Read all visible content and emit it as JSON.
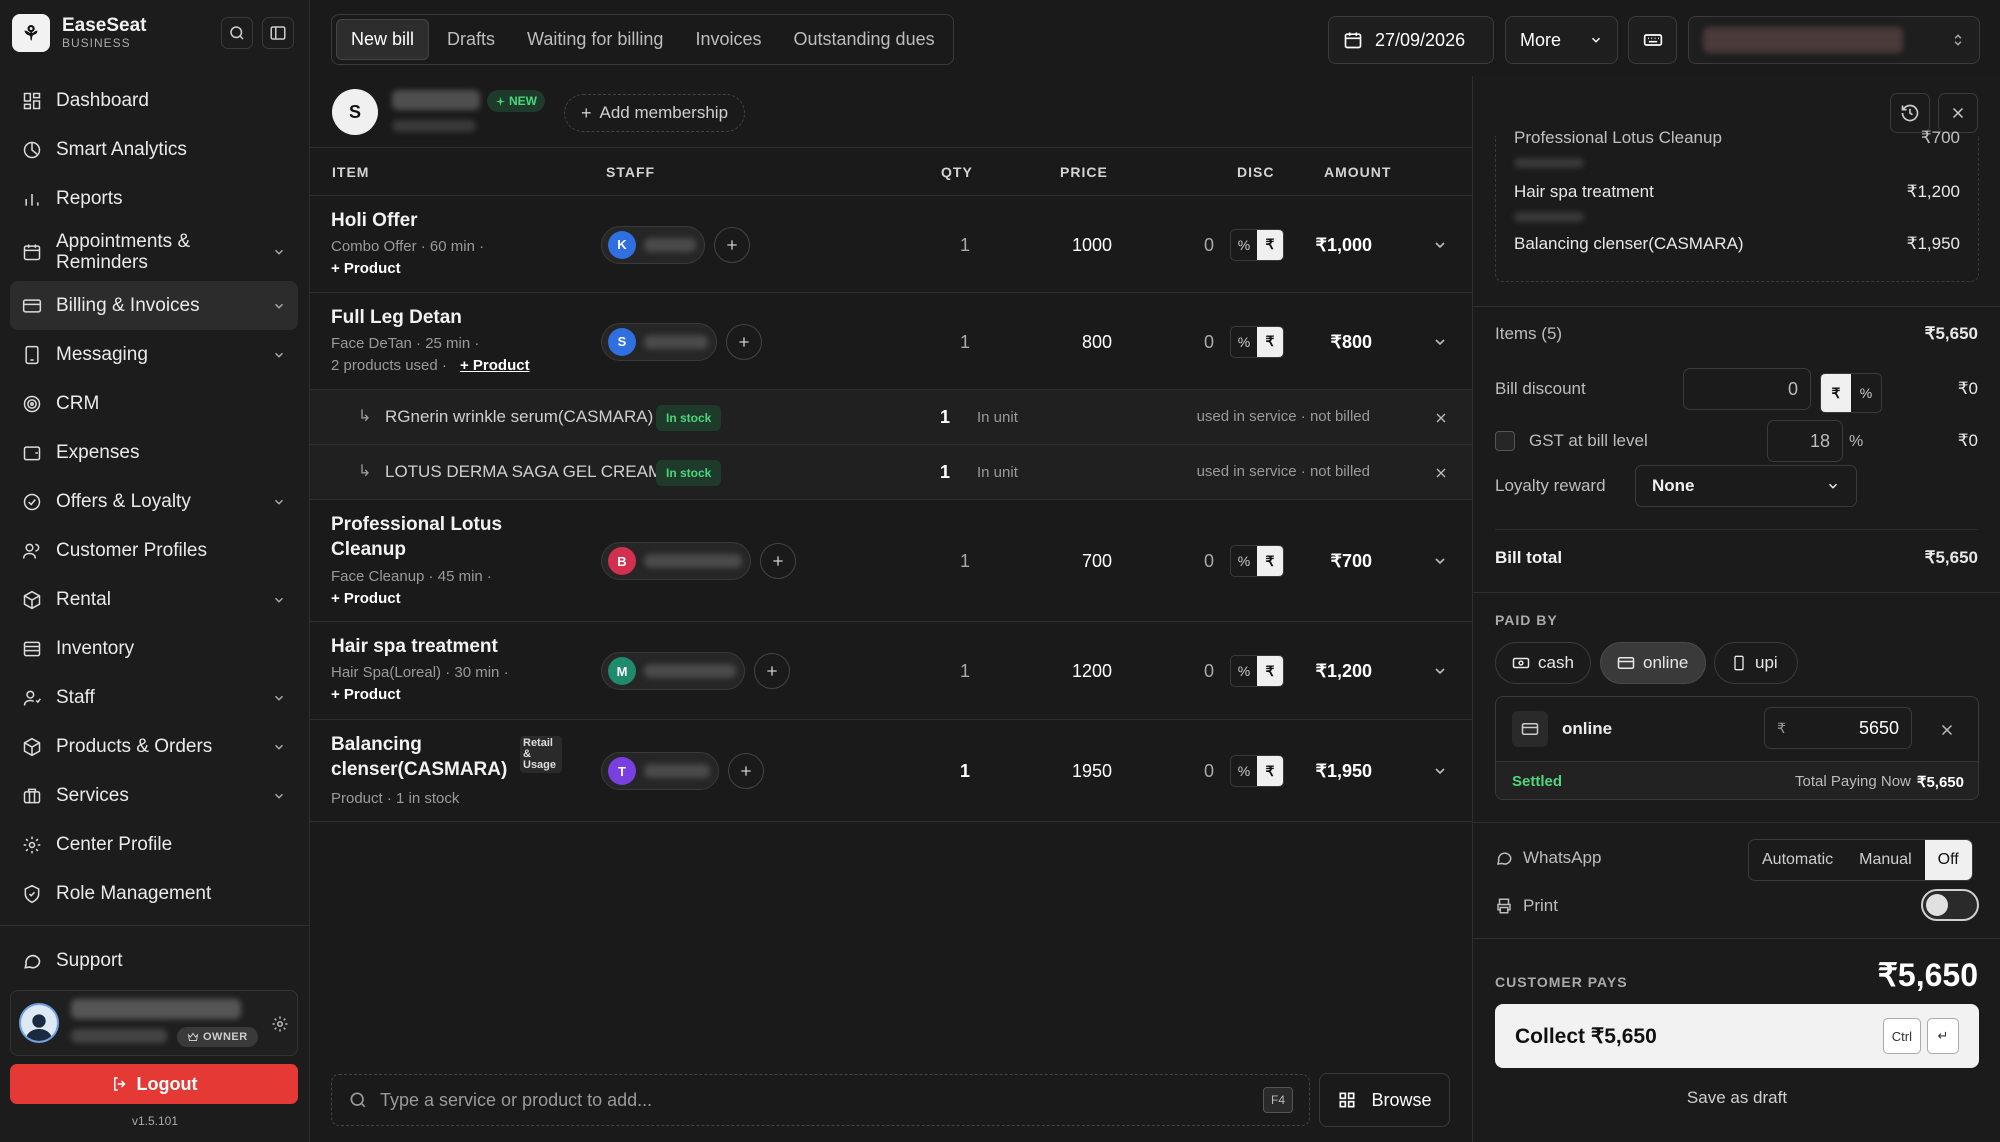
{
  "brand": {
    "name": "EaseSeat",
    "sub": "BUSINESS",
    "logo": "⚘"
  },
  "sidebar": {
    "items": [
      {
        "label": "Dashboard",
        "icon": "dashboard-icon",
        "chevron": false
      },
      {
        "label": "Smart Analytics",
        "icon": "analytics-icon",
        "chevron": false
      },
      {
        "label": "Reports",
        "icon": "reports-icon",
        "chevron": false
      },
      {
        "label": "Appointments & Reminders",
        "icon": "calendar-icon",
        "chevron": true
      },
      {
        "label": "Billing & Invoices",
        "icon": "billing-icon",
        "chevron": true,
        "active": true
      },
      {
        "label": "Messaging",
        "icon": "messaging-icon",
        "chevron": true
      },
      {
        "label": "CRM",
        "icon": "crm-icon",
        "chevron": false
      },
      {
        "label": "Expenses",
        "icon": "expenses-icon",
        "chevron": false
      },
      {
        "label": "Offers & Loyalty",
        "icon": "offers-icon",
        "chevron": true
      },
      {
        "label": "Customer Profiles",
        "icon": "customers-icon",
        "chevron": false
      },
      {
        "label": "Rental",
        "icon": "rental-icon",
        "chevron": true
      },
      {
        "label": "Inventory",
        "icon": "inventory-icon",
        "chevron": false
      },
      {
        "label": "Staff",
        "icon": "staff-icon",
        "chevron": true
      },
      {
        "label": "Products & Orders",
        "icon": "products-icon",
        "chevron": true
      },
      {
        "label": "Services",
        "icon": "services-icon",
        "chevron": true
      },
      {
        "label": "Center Profile",
        "icon": "gear-icon",
        "chevron": false
      },
      {
        "label": "Role Management",
        "icon": "shield-icon",
        "chevron": false
      }
    ],
    "support": "Support",
    "owner": "OWNER",
    "logout": "Logout",
    "version": "v1.5.101"
  },
  "tabs": [
    {
      "label": "New bill",
      "active": true
    },
    {
      "label": "Drafts"
    },
    {
      "label": "Waiting for billing"
    },
    {
      "label": "Invoices"
    },
    {
      "label": "Outstanding dues"
    }
  ],
  "topbar": {
    "date": "27/09/2026",
    "more": "More"
  },
  "customer": {
    "initial": "S",
    "badge": "NEW",
    "add_membership": "Add membership"
  },
  "table": {
    "headers": {
      "item": "ITEM",
      "staff": "STAFF",
      "qty": "QTY",
      "price": "PRICE",
      "disc": "DISC",
      "amount": "AMOUNT"
    },
    "add_product": "+ Product",
    "rows": [
      {
        "name": "Holi Offer",
        "desc": "Combo Offer · 60 min ·",
        "staff_initial": "K",
        "staff_color": "#2f6fe0",
        "qty": "1",
        "price": "1000",
        "disc": "0",
        "amount": "₹1,000"
      },
      {
        "name": "Full Leg Detan",
        "desc": "Face DeTan · 25 min ·",
        "desc2": "2 products used  ·",
        "staff_initial": "S",
        "staff_color": "#2f6fe0",
        "qty": "1",
        "price": "800",
        "disc": "0",
        "amount": "₹800"
      },
      {
        "name": "Professional Lotus Cleanup",
        "desc": "Face Cleanup · 45 min ·",
        "staff_initial": "B",
        "staff_color": "#d32f4f",
        "qty": "1",
        "price": "700",
        "disc": "0",
        "amount": "₹700"
      },
      {
        "name": "Hair spa treatment",
        "desc": "Hair Spa(Loreal) · 30 min ·",
        "staff_initial": "M",
        "staff_color": "#1f8a6e",
        "qty": "1",
        "price": "1200",
        "disc": "0",
        "amount": "₹1,200"
      },
      {
        "name": "Balancing clenser(CASMARA)",
        "desc": "Product · 1 in stock",
        "tag": "Retail & Usage",
        "staff_initial": "T",
        "staff_color": "#7a3fe0",
        "qty": "1",
        "price": "1950",
        "disc": "0",
        "amount": "₹1,950"
      }
    ],
    "subrows": [
      {
        "name": "RGnerin wrinkle serum(CASMARA)",
        "stock": "In stock",
        "qty": "1",
        "unit": "In unit",
        "note": "used in service · not billed"
      },
      {
        "name": "LOTUS DERMA SAGA GEL CREAM",
        "stock": "In stock",
        "qty": "1",
        "unit": "In unit",
        "note": "used in service · not billed"
      }
    ]
  },
  "search": {
    "placeholder": "Type a service or product to add...",
    "shortcut": "F4",
    "browse": "Browse"
  },
  "summary": {
    "lines": [
      {
        "name": "Professional Lotus Cleanup",
        "amount": "₹700"
      },
      {
        "name": "Hair spa treatment",
        "amount": "₹1,200"
      },
      {
        "name": "Balancing clenser(CASMARA)",
        "amount": "₹1,950"
      }
    ]
  },
  "bill": {
    "items_label": "Items (5)",
    "items_total": "₹5,650",
    "discount_label": "Bill discount",
    "discount_value": "0",
    "discount_amount": "₹0",
    "gst_label": "GST at bill level",
    "gst_value": "18",
    "gst_amount": "₹0",
    "loyalty_label": "Loyalty reward",
    "loyalty_value": "None",
    "total_label": "Bill total",
    "total_value": "₹5,650",
    "paid_by": "PAID BY",
    "methods": [
      {
        "label": "cash"
      },
      {
        "label": "online",
        "active": true
      },
      {
        "label": "upi"
      }
    ],
    "online_label": "online",
    "online_amount": "5650",
    "settled": "Settled",
    "paying_now": "Total Paying Now",
    "paying_now_value": "₹5,650",
    "whatsapp": "WhatsApp",
    "wa_options": [
      "Automatic",
      "Manual",
      "Off"
    ],
    "print": "Print",
    "customer_pays": "CUSTOMER PAYS",
    "customer_pays_value": "₹5,650",
    "collect": "Collect ₹5,650",
    "ctrl": "Ctrl",
    "enter": "↵",
    "save_draft": "Save as draft"
  },
  "symbols": {
    "rupee": "₹",
    "percent": "%"
  },
  "colors": {
    "accent_green": "#4cd67a",
    "logout_red": "#e53935"
  }
}
